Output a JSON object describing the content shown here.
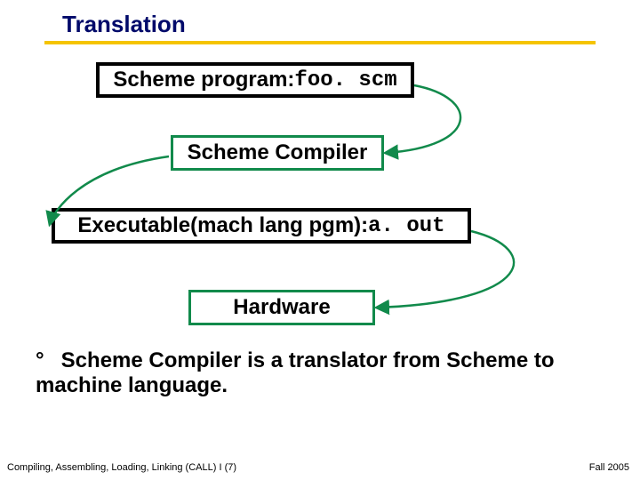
{
  "title": "Translation",
  "boxes": {
    "src_prefix": "Scheme program: ",
    "src_file": "foo. scm",
    "compiler": "Scheme Compiler",
    "exe_prefix": "Executable(mach lang pgm): ",
    "exe_file": "a. out",
    "hardware": "Hardware"
  },
  "bullet": {
    "marker": "°",
    "text": "Scheme Compiler is a translator from Scheme to machine language."
  },
  "footer": {
    "left": "Compiling, Assembling, Loading, Linking (CALL) I (7)",
    "right": "Fall 2005"
  },
  "colors": {
    "title": "#000a6a",
    "rule": "#f5c400",
    "greenBorder": "#118a4b",
    "arrow": "#118a4b"
  }
}
